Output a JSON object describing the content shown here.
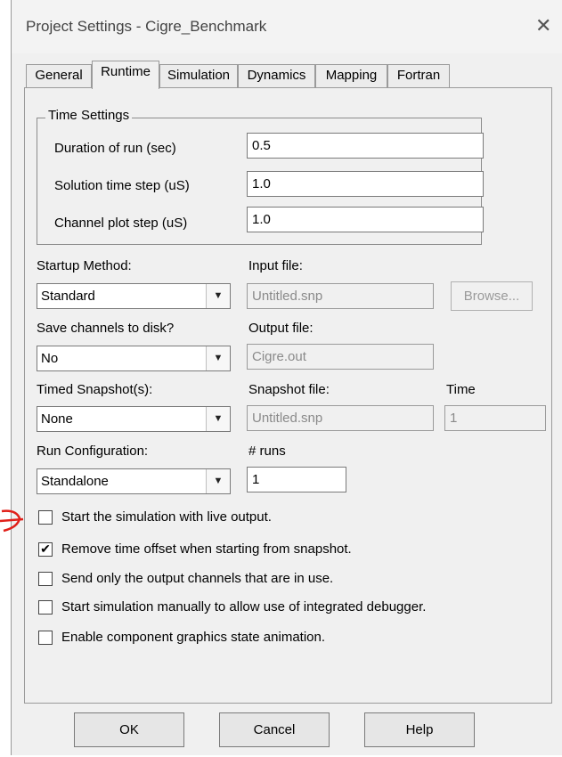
{
  "window": {
    "title": "Project Settings - Cigre_Benchmark",
    "close_icon": "close-icon"
  },
  "tabs": [
    {
      "label": "General",
      "active": false
    },
    {
      "label": "Runtime",
      "active": true
    },
    {
      "label": "Simulation",
      "active": false
    },
    {
      "label": "Dynamics",
      "active": false
    },
    {
      "label": "Mapping",
      "active": false
    },
    {
      "label": "Fortran",
      "active": false
    }
  ],
  "time_settings": {
    "group_label": "Time Settings",
    "duration": {
      "label": "Duration of run (sec)",
      "value": "0.5"
    },
    "solution_step": {
      "label": "Solution time step (uS)",
      "value": "1.0"
    },
    "plot_step": {
      "label": "Channel plot step (uS)",
      "value": "1.0"
    }
  },
  "startup": {
    "label": "Startup Method:",
    "value": "Standard",
    "input_file_label": "Input file:",
    "input_file_value": "Untitled.snp",
    "browse_label": "Browse..."
  },
  "save_channels": {
    "label": "Save channels to disk?",
    "value": "No",
    "output_file_label": "Output file:",
    "output_file_value": "Cigre.out"
  },
  "timed_snapshot": {
    "label": "Timed Snapshot(s):",
    "value": "None",
    "snapshot_file_label": "Snapshot file:",
    "snapshot_file_value": "Untitled.snp",
    "time_label": "Time",
    "time_value": "1"
  },
  "run_config": {
    "label": "Run Configuration:",
    "value": "Standalone",
    "runs_label": "# runs",
    "runs_value": "1"
  },
  "options": [
    {
      "label": "Start the simulation with live output.",
      "checked": false
    },
    {
      "label": "Remove time offset when starting from snapshot.",
      "checked": true
    },
    {
      "label": "Send only the output channels that are in use.",
      "checked": false
    },
    {
      "label": "Start simulation manually to allow use of integrated debugger.",
      "checked": false
    },
    {
      "label": "Enable component graphics state animation.",
      "checked": false
    }
  ],
  "buttons": {
    "ok": "OK",
    "cancel": "Cancel",
    "help": "Help"
  },
  "colors": {
    "annotation": "#e0201a",
    "dialog_bg": "#f0f0f0"
  }
}
